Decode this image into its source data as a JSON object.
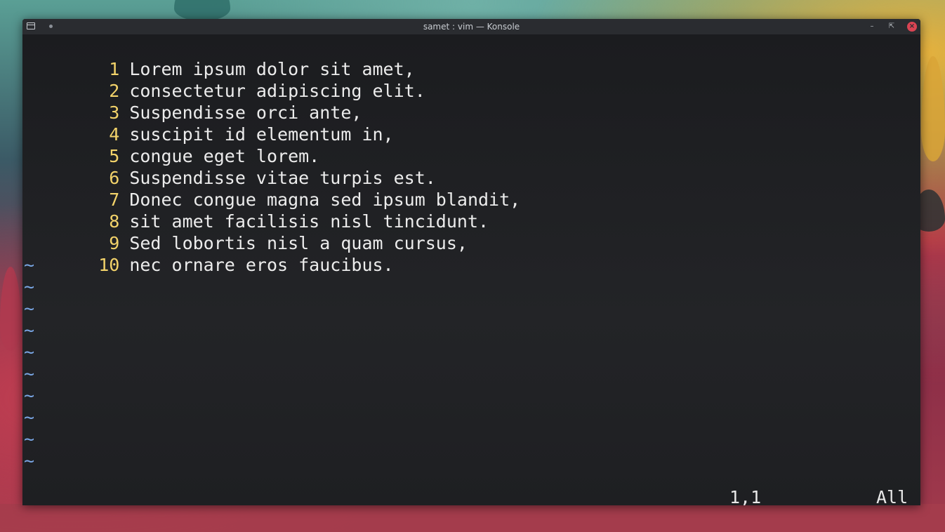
{
  "window": {
    "title": "samet : vim — Konsole"
  },
  "editor": {
    "lines": [
      {
        "num": "1",
        "text": "Lorem ipsum dolor sit amet,"
      },
      {
        "num": "2",
        "text": "consectetur adipiscing elit."
      },
      {
        "num": "3",
        "text": "Suspendisse orci ante,"
      },
      {
        "num": "4",
        "text": "suscipit id elementum in,"
      },
      {
        "num": "5",
        "text": "congue eget lorem."
      },
      {
        "num": "6",
        "text": "Suspendisse vitae turpis est."
      },
      {
        "num": "7",
        "text": "Donec congue magna sed ipsum blandit,"
      },
      {
        "num": "8",
        "text": "sit amet facilisis nisl tincidunt."
      },
      {
        "num": "9",
        "text": "Sed lobortis nisl a quam cursus,"
      },
      {
        "num": "10",
        "text": "nec ornare eros faucibus."
      }
    ],
    "tilde": "~",
    "status_position": "1,1",
    "status_scroll": "All"
  },
  "colors": {
    "line_number": "#f3d36a",
    "tilde": "#7aa7e6",
    "close_button": "#da4453"
  },
  "icons": {
    "app": "terminal-icon",
    "minimize": "minimize-icon",
    "maximize": "maximize-icon",
    "close": "close-icon"
  }
}
